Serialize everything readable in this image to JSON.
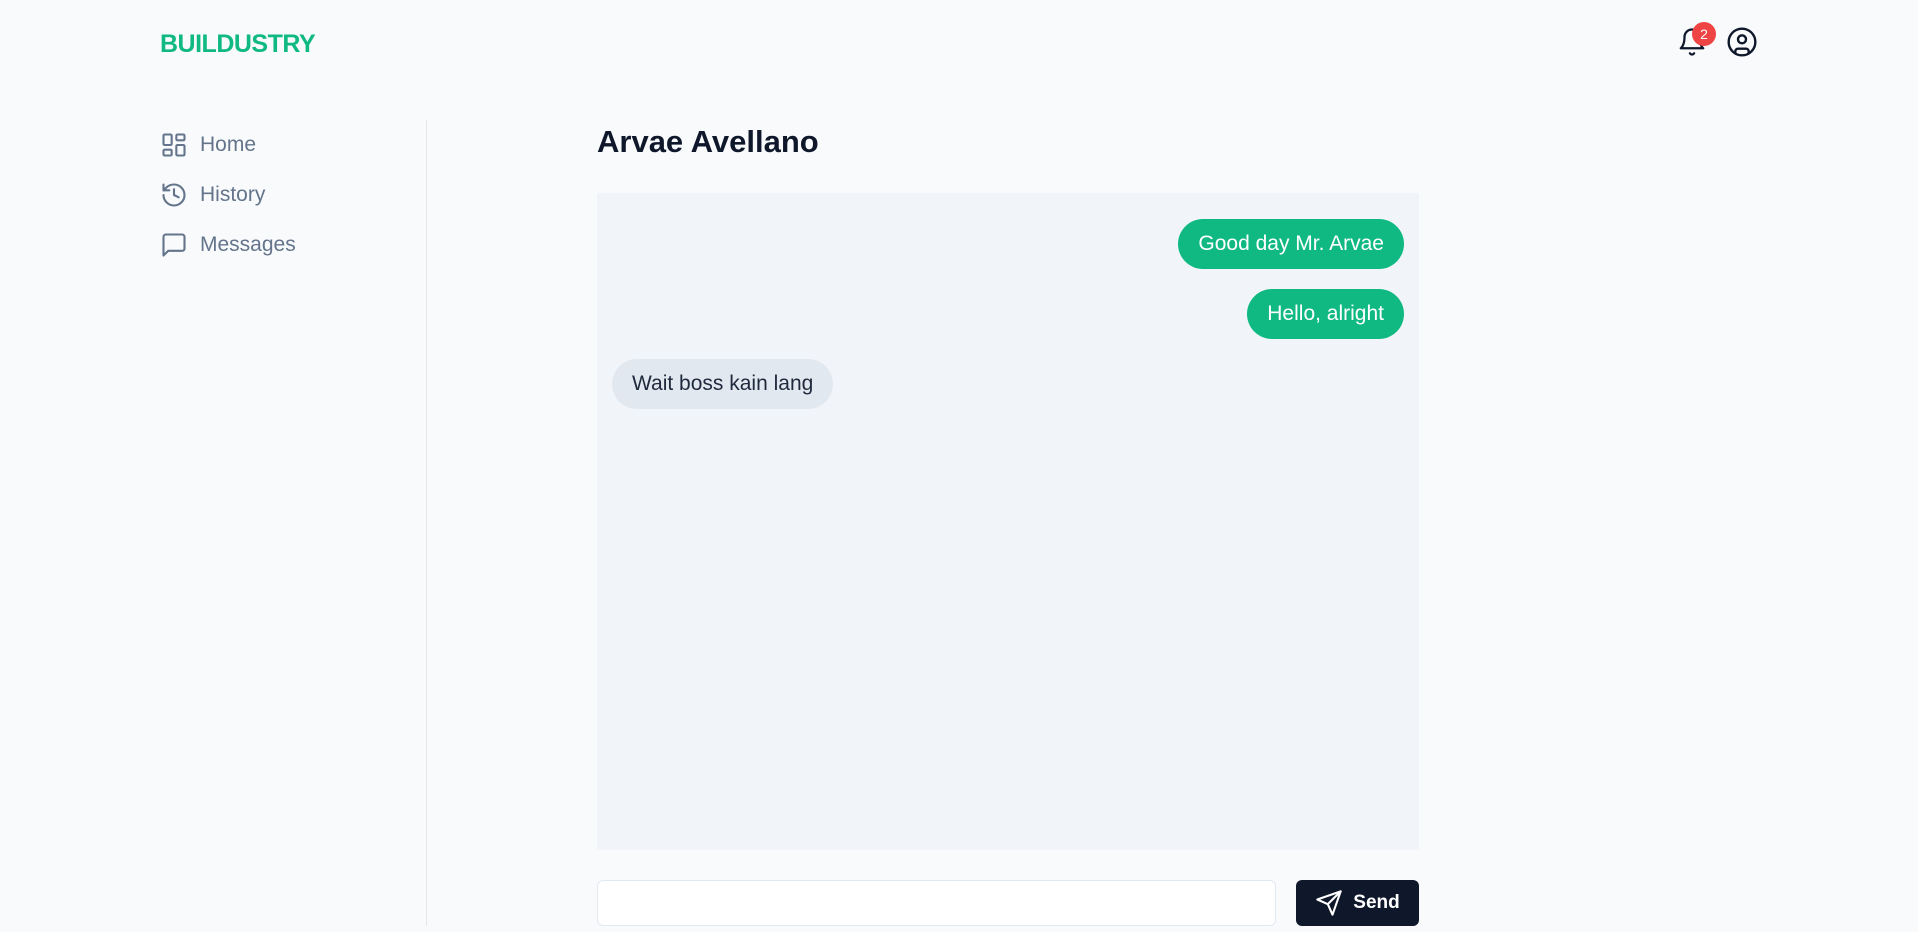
{
  "brand": {
    "name": "BUILDUSTRY",
    "accent_color": "#10b981"
  },
  "header": {
    "notifications": {
      "icon": "bell-icon",
      "count": "2"
    },
    "account_icon": "user-circle-icon"
  },
  "sidebar": {
    "items": [
      {
        "label": "Home",
        "icon": "dashboard-icon"
      },
      {
        "label": "History",
        "icon": "history-icon"
      },
      {
        "label": "Messages",
        "icon": "message-icon"
      }
    ]
  },
  "conversation": {
    "title": "Arvae Avellano",
    "messages": [
      {
        "text": "Good day Mr. Arvae",
        "direction": "outgoing"
      },
      {
        "text": "Hello, alright",
        "direction": "outgoing"
      },
      {
        "text": "Wait boss kain lang",
        "direction": "incoming"
      }
    ]
  },
  "composer": {
    "value": "",
    "send_label": "Send",
    "send_icon": "send-icon"
  }
}
